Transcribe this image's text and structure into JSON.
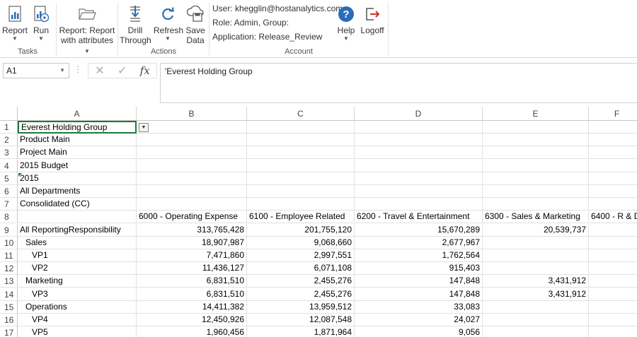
{
  "ribbon": {
    "tasks": {
      "label": "Tasks",
      "buttons": [
        {
          "label": "Report",
          "has_caret": true,
          "icon": "report-icon"
        },
        {
          "label": "Run",
          "has_caret": true,
          "icon": "run-icon"
        }
      ]
    },
    "report_attr": {
      "line1": "Report: Report",
      "line2": "with attributes",
      "icon": "folder-icon"
    },
    "actions": {
      "label": "Actions",
      "drill": {
        "line1": "Drill",
        "line2": "Through",
        "icon": "drill-through-icon"
      },
      "refresh": {
        "label": "Refresh",
        "icon": "refresh-icon"
      },
      "save": {
        "line1": "Save",
        "line2": "Data",
        "icon": "save-data-icon"
      }
    },
    "account": {
      "label": "Account",
      "user": "User: khegglin@hostanalytics.com",
      "role": "Role: Admin, Group:",
      "application": "Application: Release_Review",
      "help": {
        "label": "Help",
        "icon": "help-icon"
      },
      "logoff": {
        "label": "Logoff",
        "icon": "logoff-icon"
      }
    },
    "accent_color": "#2b6cb8"
  },
  "formula_bar": {
    "name_box": "A1",
    "formula": "'Everest Holding Group"
  },
  "sheet": {
    "columns": [
      "A",
      "B",
      "C",
      "D",
      "E",
      "F"
    ],
    "rows": [
      {
        "n": "1",
        "a": "Everest Holding Group",
        "b": "",
        "c": "",
        "d": "",
        "e": ""
      },
      {
        "n": "2",
        "a": "Product Main",
        "b": "",
        "c": "",
        "d": "",
        "e": ""
      },
      {
        "n": "3",
        "a": "Project Main",
        "b": "",
        "c": "",
        "d": "",
        "e": ""
      },
      {
        "n": "4",
        "a": "2015 Budget",
        "b": "",
        "c": "",
        "d": "",
        "e": ""
      },
      {
        "n": "5",
        "a": "2015",
        "b": "",
        "c": "",
        "d": "",
        "e": ""
      },
      {
        "n": "6",
        "a": "All Departments",
        "b": "",
        "c": "",
        "d": "",
        "e": ""
      },
      {
        "n": "7",
        "a": "Consolidated (CC)",
        "b": "",
        "c": "",
        "d": "",
        "e": ""
      },
      {
        "n": "8",
        "a": "",
        "b": "6000 - Operating Expense",
        "c": "6100 - Employee Related",
        "d": "6200 - Travel & Entertainment",
        "e": "6300 - Sales & Marketing",
        "f": "6400 - R & D"
      },
      {
        "n": "9",
        "a": "All ReportingResponsibility",
        "b": "313,765,428",
        "c": "201,755,120",
        "d": "15,670,289",
        "e": "20,539,737"
      },
      {
        "n": "10",
        "a": "Sales",
        "b": "18,907,987",
        "c": "9,068,660",
        "d": "2,677,967",
        "e": ""
      },
      {
        "n": "11",
        "a": "VP1",
        "b": "7,471,860",
        "c": "2,997,551",
        "d": "1,762,564",
        "e": ""
      },
      {
        "n": "12",
        "a": "VP2",
        "b": "11,436,127",
        "c": "6,071,108",
        "d": "915,403",
        "e": ""
      },
      {
        "n": "13",
        "a": "Marketing",
        "b": "6,831,510",
        "c": "2,455,276",
        "d": "147,848",
        "e": "3,431,912"
      },
      {
        "n": "14",
        "a": "VP3",
        "b": "6,831,510",
        "c": "2,455,276",
        "d": "147,848",
        "e": "3,431,912"
      },
      {
        "n": "15",
        "a": "Operations",
        "b": "14,411,382",
        "c": "13,959,512",
        "d": "33,083",
        "e": ""
      },
      {
        "n": "16",
        "a": "VP4",
        "b": "12,450,926",
        "c": "12,087,548",
        "d": "24,027",
        "e": ""
      },
      {
        "n": "17",
        "a": "VP5",
        "b": "1,960,456",
        "c": "1,871,964",
        "d": "9,056",
        "e": ""
      }
    ]
  }
}
